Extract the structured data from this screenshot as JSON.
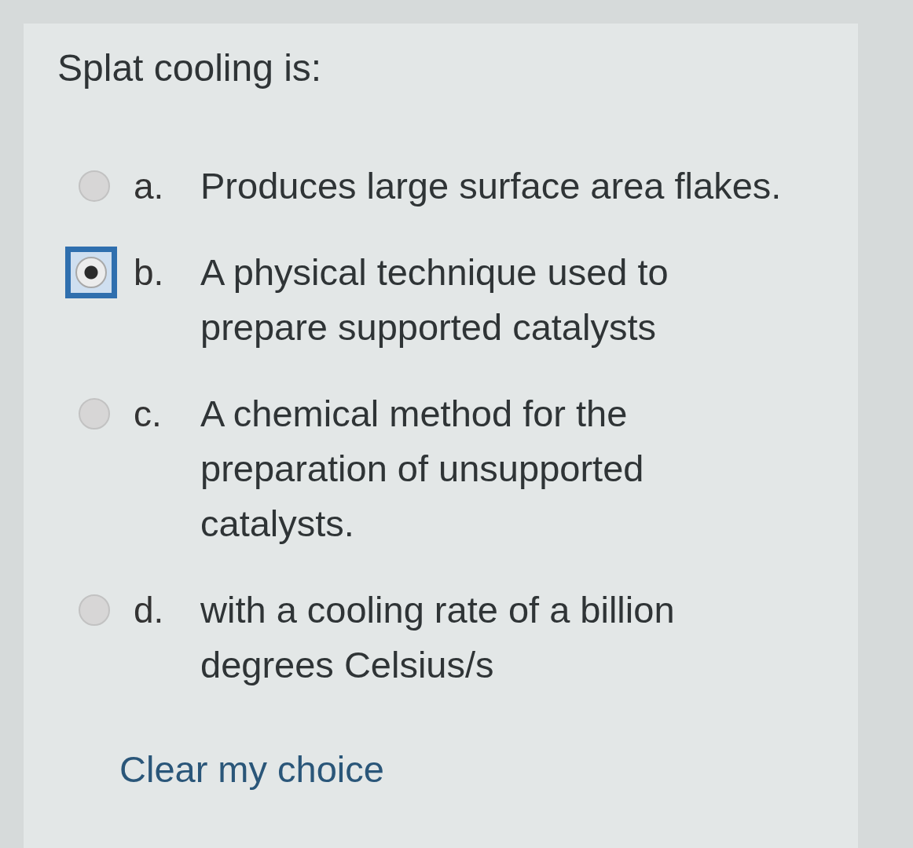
{
  "question": {
    "text": "Splat cooling is:"
  },
  "options": [
    {
      "letter": "a.",
      "lines": [
        "Produces large surface area flakes."
      ],
      "selected": false,
      "focused": false
    },
    {
      "letter": "b.",
      "lines": [
        "A physical technique used to",
        "prepare supported catalysts"
      ],
      "selected": true,
      "focused": true
    },
    {
      "letter": "c.",
      "lines": [
        "A chemical method for the",
        "preparation of unsupported",
        "catalysts."
      ],
      "selected": false,
      "focused": false
    },
    {
      "letter": "d.",
      "lines": [
        "with a cooling rate of a billion",
        "degrees Celsius/s"
      ],
      "selected": false,
      "focused": false
    }
  ],
  "clear_link": {
    "label": "Clear my choice"
  }
}
